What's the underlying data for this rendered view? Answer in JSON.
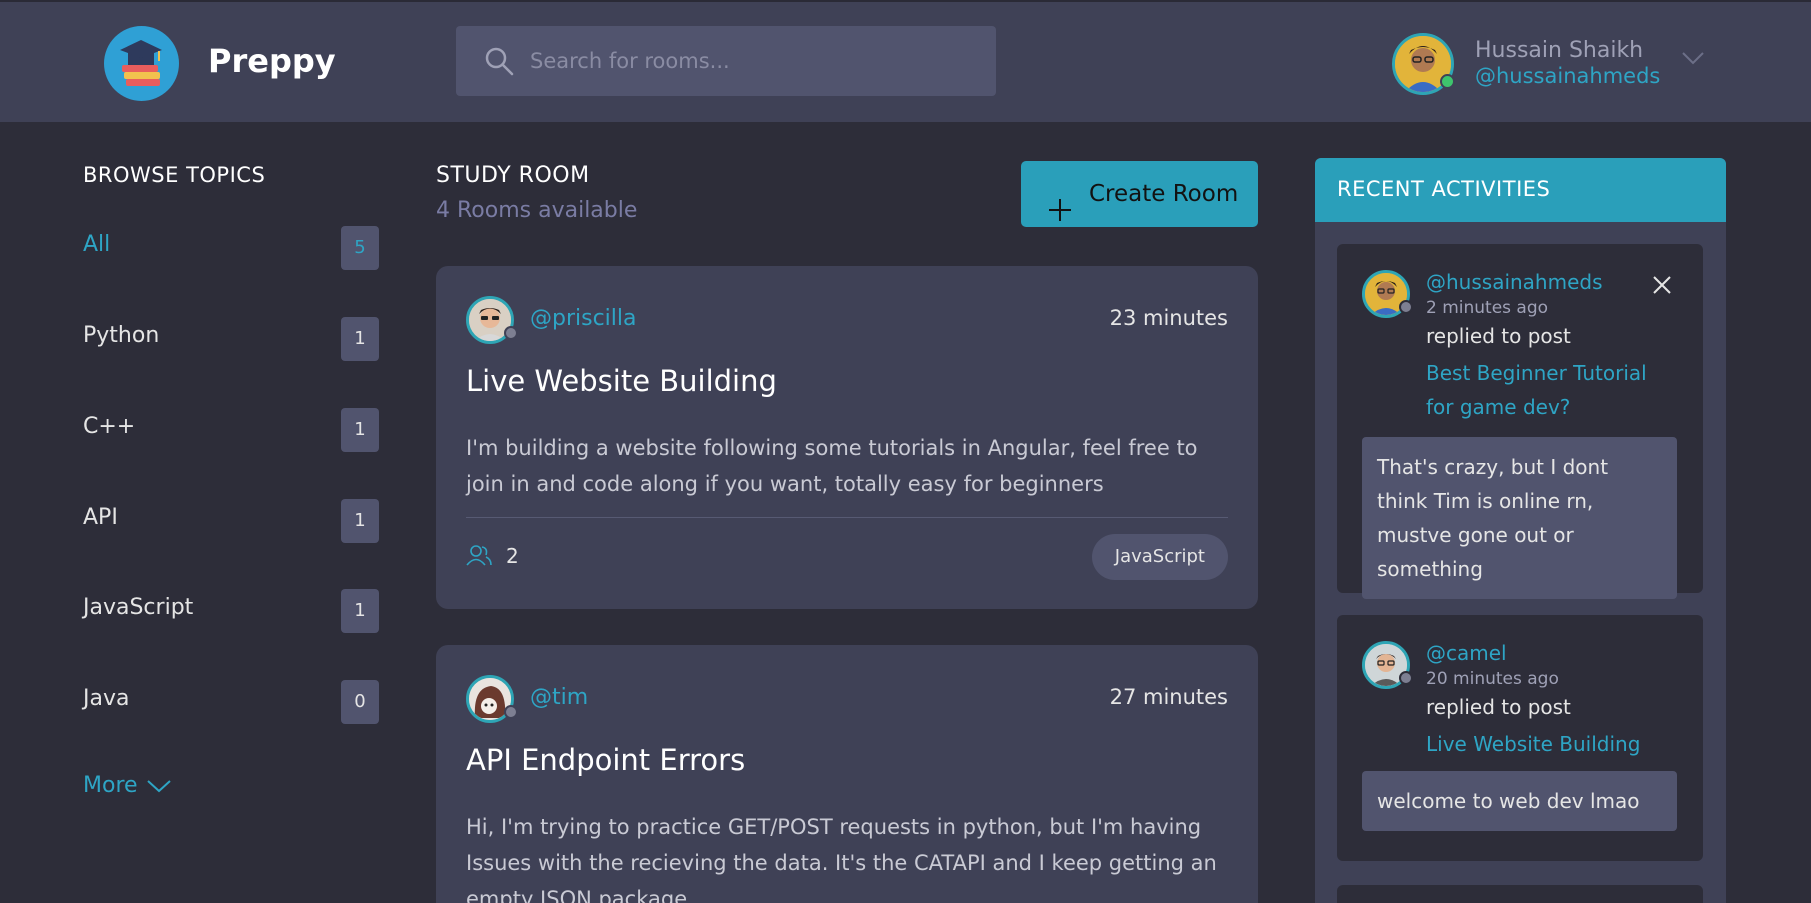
{
  "app": {
    "brand": "Preppy"
  },
  "search": {
    "placeholder": "Search for rooms..."
  },
  "user": {
    "name": "Hussain Shaikh",
    "handle": "@hussainahmeds",
    "status": "online"
  },
  "topics": {
    "title": "BROWSE TOPICS",
    "items": [
      {
        "label": "All",
        "count": "5",
        "active": true
      },
      {
        "label": "Python",
        "count": "1"
      },
      {
        "label": "C++",
        "count": "1"
      },
      {
        "label": "API",
        "count": "1"
      },
      {
        "label": "JavaScript",
        "count": "1"
      },
      {
        "label": "Java",
        "count": "0"
      }
    ],
    "more_label": "More"
  },
  "main": {
    "title": "STUDY ROOM",
    "subtitle": "4 Rooms available",
    "create_label": "Create Room",
    "rooms": [
      {
        "host": "@priscilla",
        "time": "23 minutes",
        "title": "Live Website Building",
        "description": "I'm building a website following some tutorials in Angular, feel free to join in and code along if you want, totally easy for beginners",
        "participants": "2",
        "topic": "JavaScript"
      },
      {
        "host": "@tim",
        "time": "27 minutes",
        "title": "API Endpoint Errors",
        "description": "Hi, I'm trying to practice GET/POST requests in python, but I'm having Issues with the recieving the data. It's the CATAPI and I keep getting an empty JSON package."
      }
    ]
  },
  "activities": {
    "title": "RECENT ACTIVITIES",
    "items": [
      {
        "user": "@hussainahmeds",
        "ago": "2 minutes ago",
        "action": "replied to post",
        "post": "Best Beginner Tutorial for game dev?",
        "message": "That's crazy, but I dont think Tim is online rn, mustve gone out or something"
      },
      {
        "user": "@camel",
        "ago": "20 minutes ago",
        "action": "replied to post",
        "post": "Live Website Building",
        "message": "welcome to web dev lmao"
      }
    ]
  },
  "colors": {
    "background": "#2d2d39",
    "panel": "#3f4156",
    "accent": "#2a9fba",
    "link": "#2ea5c5",
    "online": "#3ec46d"
  }
}
